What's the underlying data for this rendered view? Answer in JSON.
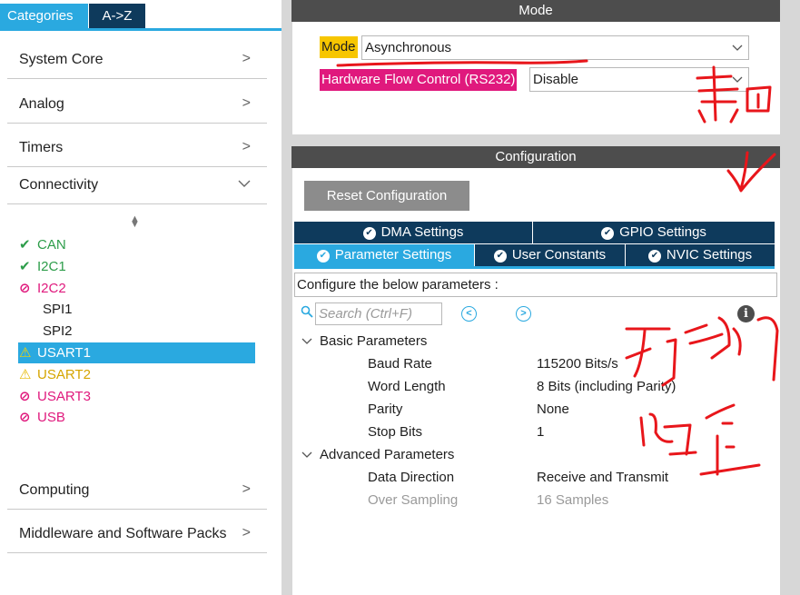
{
  "tabs": {
    "categories": "Categories",
    "az": "A->Z"
  },
  "categories": [
    {
      "label": "System Core",
      "chevron": ">"
    },
    {
      "label": "Analog",
      "chevron": ">"
    },
    {
      "label": "Timers",
      "chevron": ">"
    },
    {
      "label": "Connectivity",
      "chevron": "v"
    },
    {
      "label": "Computing",
      "chevron": ">"
    },
    {
      "label": "Middleware and Software Packs",
      "chevron": ">"
    }
  ],
  "connectivity": [
    {
      "name": "CAN",
      "status": "ok",
      "icon": "check-icon",
      "glyph": "✔"
    },
    {
      "name": "I2C1",
      "status": "ok",
      "icon": "check-icon",
      "glyph": "✔"
    },
    {
      "name": "I2C2",
      "status": "conflict",
      "icon": "forbidden-icon",
      "glyph": "⊘"
    },
    {
      "name": "SPI1",
      "status": "none",
      "icon": "",
      "glyph": ""
    },
    {
      "name": "SPI2",
      "status": "none",
      "icon": "",
      "glyph": ""
    },
    {
      "name": "USART1",
      "status": "warning",
      "icon": "warning-icon",
      "glyph": "⚠",
      "selected": true
    },
    {
      "name": "USART2",
      "status": "warning",
      "icon": "warning-icon",
      "glyph": "⚠"
    },
    {
      "name": "USART3",
      "status": "conflict",
      "icon": "forbidden-icon",
      "glyph": "⊘"
    },
    {
      "name": "USB",
      "status": "conflict",
      "icon": "forbidden-icon",
      "glyph": "⊘"
    }
  ],
  "mode": {
    "header": "Mode",
    "mode_label": "Mode",
    "mode_value": "Asynchronous",
    "hfc_label": "Hardware Flow Control (RS232)",
    "hfc_value": "Disable"
  },
  "configuration": {
    "header": "Configuration",
    "reset_label": "Reset Configuration",
    "tabs_row1": [
      "DMA Settings",
      "GPIO Settings"
    ],
    "tabs_row2": [
      "Parameter Settings",
      "User Constants",
      "NVIC Settings"
    ],
    "active_tab": "Parameter Settings",
    "hint": "Configure the below parameters :",
    "search_placeholder": "Search (Ctrl+F)",
    "groups": [
      {
        "title": "Basic Parameters",
        "params": [
          {
            "name": "Baud Rate",
            "value": "115200 Bits/s"
          },
          {
            "name": "Word Length",
            "value": "8 Bits (including Parity)"
          },
          {
            "name": "Parity",
            "value": "None"
          },
          {
            "name": "Stop Bits",
            "value": "1"
          }
        ]
      },
      {
        "title": "Advanced Parameters",
        "params": [
          {
            "name": "Data Direction",
            "value": "Receive and Transmit"
          },
          {
            "name": "Over Sampling",
            "value": "16 Samples",
            "disabled": true
          }
        ]
      }
    ]
  },
  "colors": {
    "accent": "#2aa9e0",
    "navy": "#0e3a5c",
    "ok": "#2d9d4a",
    "conflict": "#e0197d",
    "warning": "#f5d400",
    "annotation_ink": "#e8161b"
  }
}
